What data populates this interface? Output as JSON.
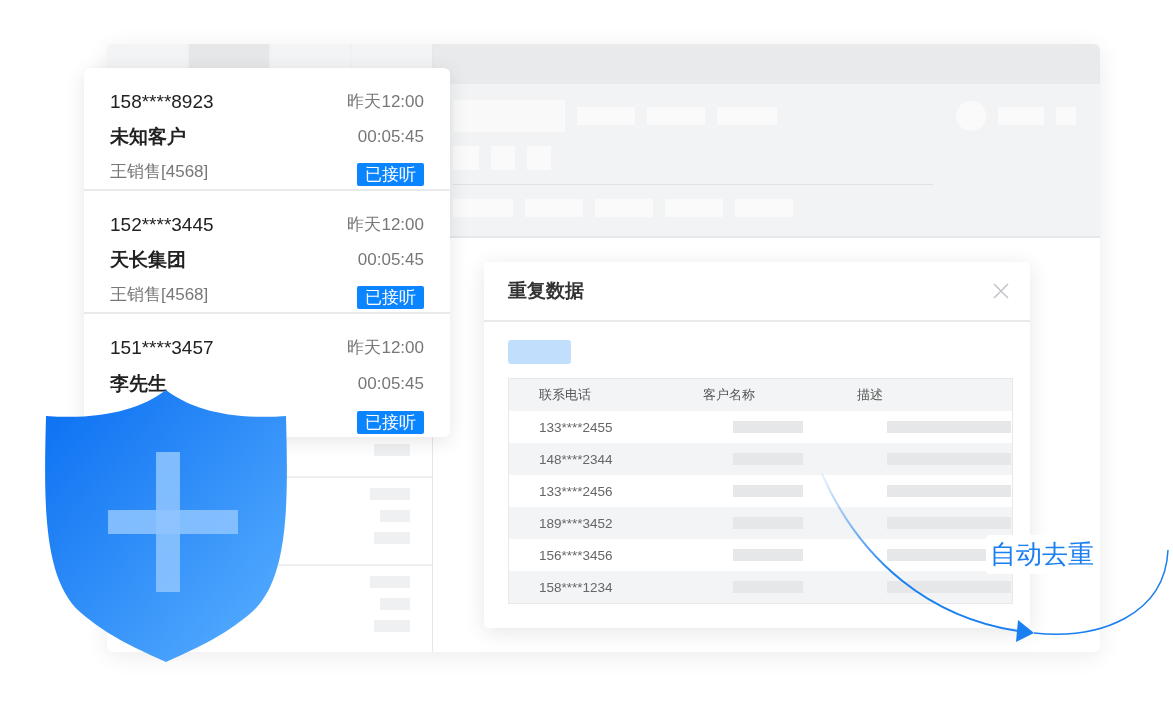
{
  "calls": [
    {
      "phone": "158****8923",
      "name": "未知客户",
      "agent": "王销售[4568]",
      "time": "昨天12:00",
      "duration": "00:05:45",
      "status": "已接听"
    },
    {
      "phone": "152****3445",
      "name": "天长集团",
      "agent": "王销售[4568]",
      "time": "昨天12:00",
      "duration": "00:05:45",
      "status": "已接听"
    },
    {
      "phone": "151****3457",
      "name": "李先生",
      "time": "昨天12:00",
      "duration": "00:05:45",
      "status": "已接听"
    }
  ],
  "dialog": {
    "title": "重复数据",
    "columns": [
      "联系电话",
      "客户名称",
      "描述"
    ],
    "rows": [
      {
        "phone": "133****2455"
      },
      {
        "phone": "148****2344"
      },
      {
        "phone": "133****2456"
      },
      {
        "phone": "189****3452"
      },
      {
        "phone": "156****3456"
      },
      {
        "phone": "158****1234"
      }
    ]
  },
  "annotation": "自动去重"
}
